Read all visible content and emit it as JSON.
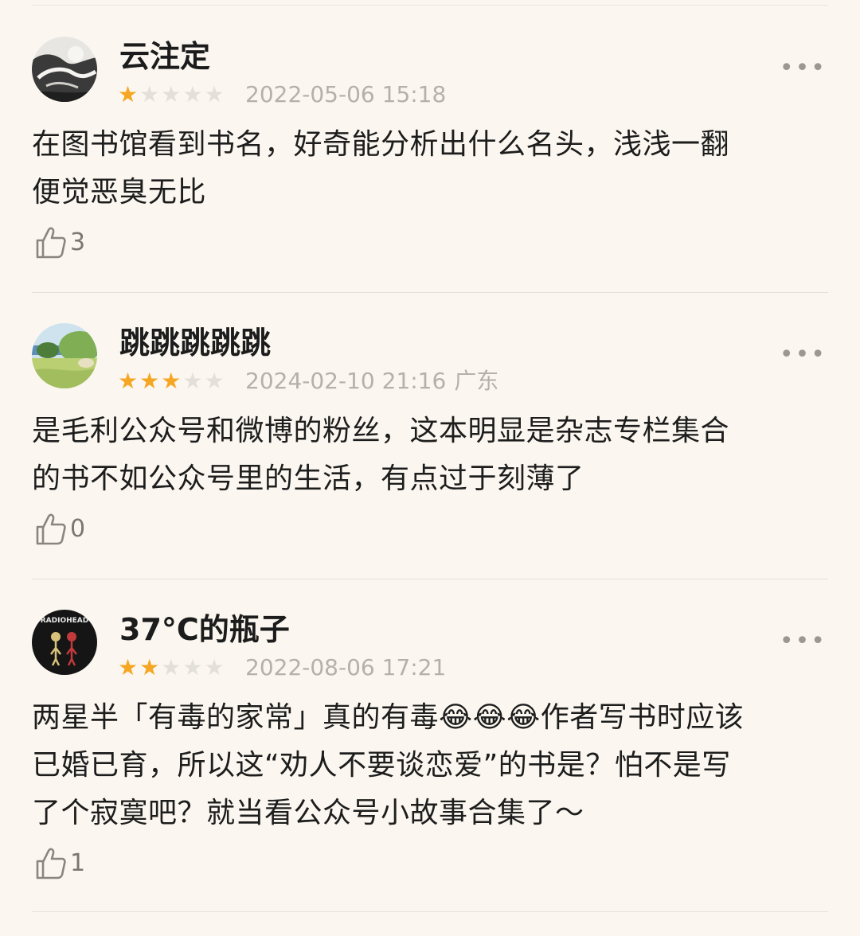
{
  "reviews": [
    {
      "username": "云注定",
      "rating": 1,
      "date": "2022-05-06 15:18",
      "region": "",
      "content": "在图书馆看到书名，好奇能分析出什么名头，浅浅一翻\n便觉恶臭无比",
      "likes": "3",
      "avatar_icon": "ink-painting-avatar-icon"
    },
    {
      "username": "跳跳跳跳跳",
      "rating": 3,
      "date": "2024-02-10 21:16",
      "region": "广东",
      "content": "是毛利公众号和微博的粉丝，这本明显是杂志专栏集合\n的书不如公众号里的生活，有点过于刻薄了",
      "likes": "0",
      "avatar_icon": "landscape-avatar-icon"
    },
    {
      "username": "37°C的瓶子",
      "rating": 2,
      "date": "2022-08-06 17:21",
      "region": "",
      "content": "两星半「有毒的家常」真的有毒😂😂😂作者写书时应该\n已婚已育，所以这“劝人不要谈恋爱”的书是？怕不是写\n了个寂寞吧？就当看公众号小故事合集了～",
      "likes": "1",
      "avatar_icon": "radiohead-avatar-icon",
      "avatar_text": "RADIOHEAD"
    }
  ],
  "icons": {
    "like": "thumbs-up-icon",
    "more": "more-dots-icon",
    "star": "star-icon"
  },
  "colors": {
    "background": "#fbf7f0",
    "star_on": "#f5a623",
    "star_off": "#e3e0da",
    "meta_text": "#b5b0a8"
  }
}
